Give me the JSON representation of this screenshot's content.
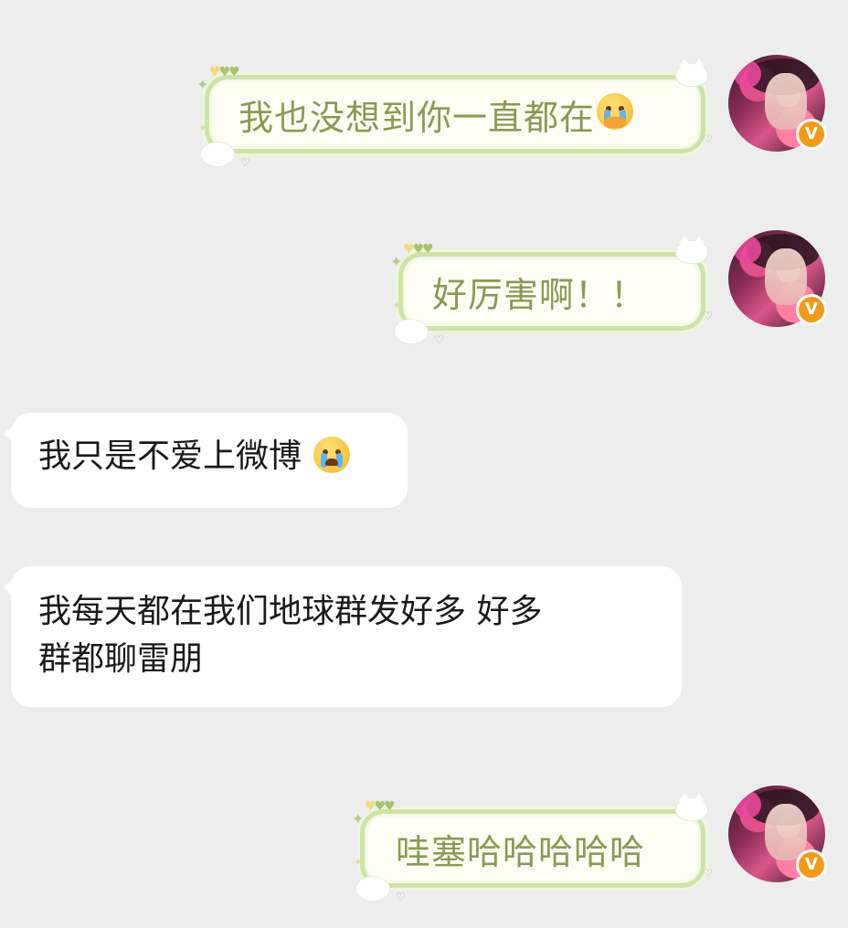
{
  "messages": [
    {
      "side": "right",
      "text": "我也没想到你一直都在",
      "emoji": "tearful-covering-mouth-emoji"
    },
    {
      "side": "right",
      "text": "好厉害啊！！"
    },
    {
      "side": "left",
      "text": "我只是不爱上微博",
      "emoji": "loudly-crying-emoji"
    },
    {
      "side": "left",
      "text_line1": "我每天都在我们地球群发好多 好多",
      "text_line2": "群都聊雷朋"
    },
    {
      "side": "right",
      "text": "哇塞哈哈哈哈哈"
    }
  ],
  "badge": {
    "label": "V",
    "color": "#f39a18"
  },
  "colors": {
    "background": "#ededee",
    "outgoing_text": "#8a9a55",
    "outgoing_border": "#cfe3a9",
    "incoming_bg": "#ffffff"
  }
}
